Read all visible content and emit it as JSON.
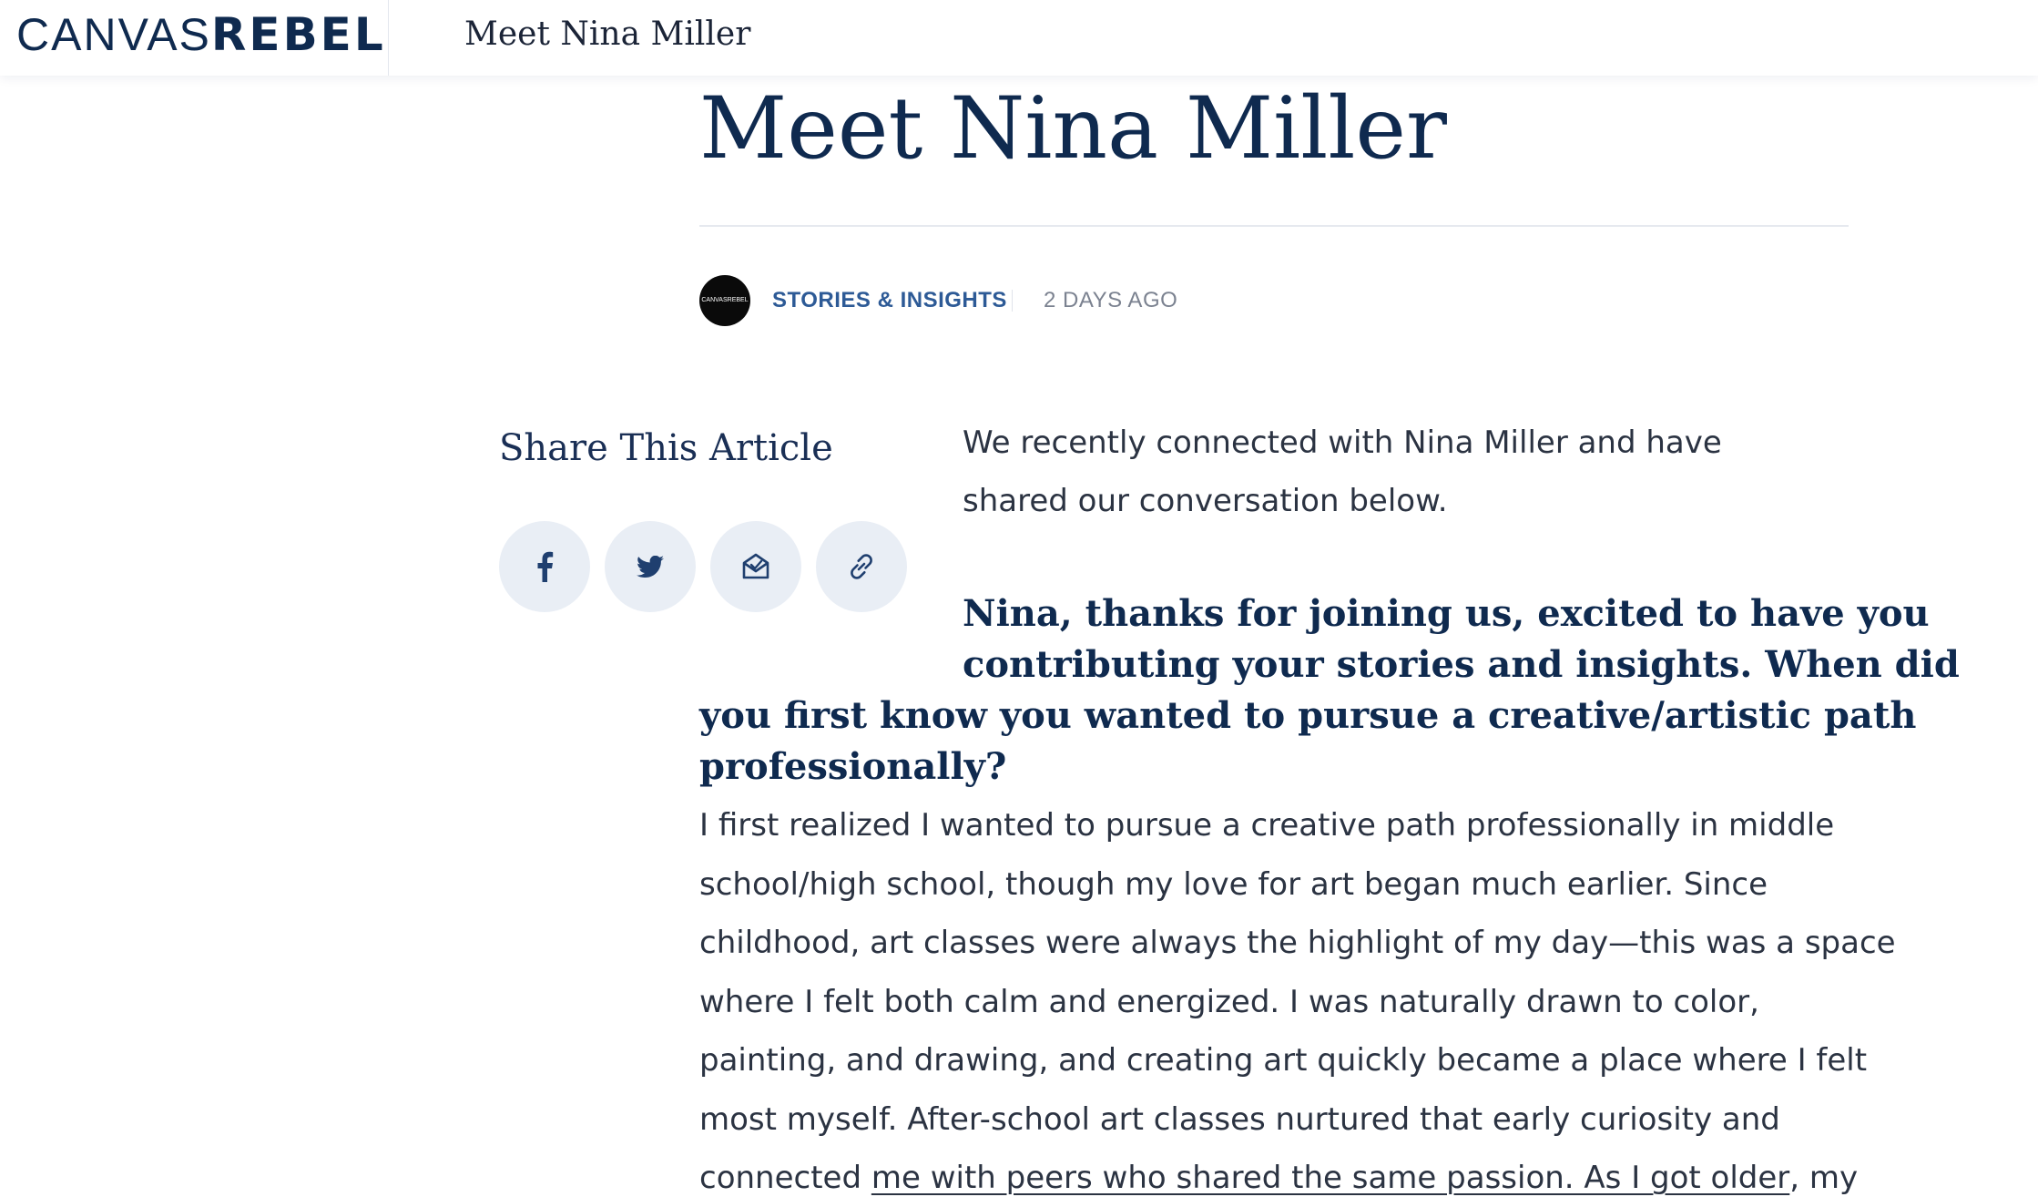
{
  "topbar": {
    "logo_light": "CANVAS",
    "logo_bold": "REBEL",
    "page_title": "Meet Nina Miller"
  },
  "article": {
    "headline": "Meet Nina Miller",
    "avatar_text": "CANVASREBEL",
    "category": "STORIES & INSIGHTS",
    "date": "2 DAYS AGO",
    "intro": "We recently connected with Nina Miller and have shared our conversation below.",
    "question_line1": "Nina, thanks for joining us, excited to have you",
    "question_line2": "contributing your stories and insights. When did",
    "question_line3": "you first know you wanted to pursue a creative/artistic path",
    "question_line4": "professionally?",
    "answer_lines": [
      "I first realized I wanted to pursue a creative path professionally in middle",
      "school/high school, though my love for art began much earlier. Since",
      "childhood, art classes were always the highlight of my day—this was a space",
      "where I felt both calm and energized. I was naturally drawn to color,",
      "painting, and drawing, and creating art quickly became a place where I felt",
      "most myself. After-school art classes nurtured that early curiosity and"
    ],
    "answer_last_prefix": "connected ",
    "answer_last_link": "me with peers who shared the same passion. As I got older",
    "answer_last_suffix": ", my"
  },
  "share": {
    "title": "Share This Article",
    "buttons": [
      {
        "icon": "facebook-icon",
        "label": "f"
      },
      {
        "icon": "twitter-icon",
        "label": ""
      },
      {
        "icon": "email-icon",
        "label": ""
      },
      {
        "icon": "link-icon",
        "label": ""
      }
    ]
  },
  "colors": {
    "brand_navy": "#0f2a4f",
    "category_blue": "#2d5a96",
    "share_button_bg": "#e9eef5",
    "body_text": "#2b3342",
    "meta_gray": "#7b8290"
  }
}
